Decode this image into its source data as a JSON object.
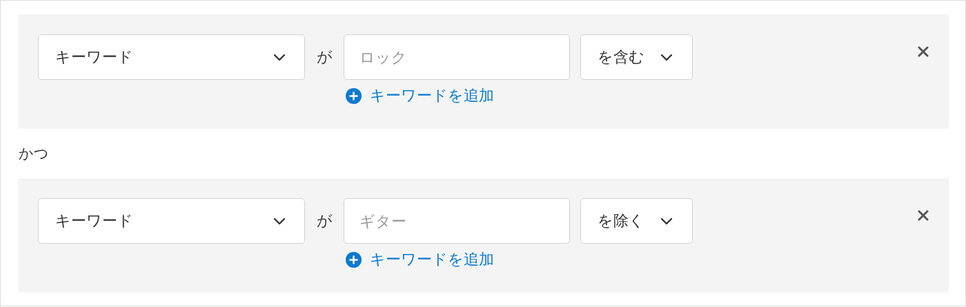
{
  "conditions": [
    {
      "field": "キーワード",
      "connector": "が",
      "keyword_placeholder": "ロック",
      "add_link": "キーワードを追加",
      "operator": "を含む"
    },
    {
      "field": "キーワード",
      "connector": "が",
      "keyword_placeholder": "ギター",
      "add_link": "キーワードを追加",
      "operator": "を除く"
    }
  ],
  "joiner": "かつ"
}
